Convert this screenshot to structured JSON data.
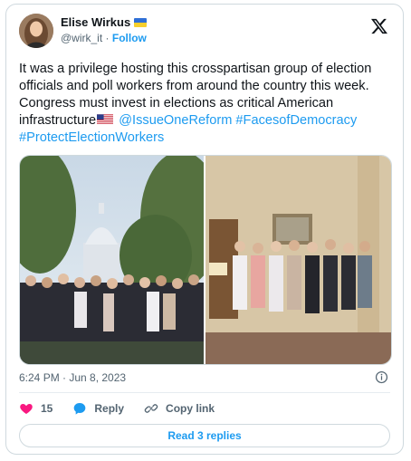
{
  "author": {
    "name": "Elise Wirkus",
    "handle": "@wirk_it",
    "separator": " · ",
    "follow_label": "Follow",
    "name_flag_icon": "ukraine-flag-icon"
  },
  "brand_icon": "x-logo-icon",
  "tweet": {
    "text_part1": "It was a privilege hosting this crosspartisan group of election officials and poll workers from around the country this week. Congress must invest in elections as critical American infrastructure",
    "inline_flag_icon": "us-flag-icon",
    "mention": "@IssueOneReform",
    "hashtag1": "#FacesofDemocracy",
    "hashtag2": "#ProtectElectionWorkers"
  },
  "media": {
    "photo1": "group-photo-capitol-outdoors",
    "photo2": "group-photo-office-indoors"
  },
  "meta": {
    "timestamp": "6:24 PM · Jun 8, 2023",
    "info_icon": "info-icon"
  },
  "actions": {
    "like_count": "15",
    "reply_label": "Reply",
    "copy_link_label": "Copy link"
  },
  "read_replies_label": "Read 3 replies",
  "colors": {
    "accent": "#1d9bf0",
    "like": "#f91880",
    "text": "#0f1419",
    "muted": "#536471",
    "border": "#cfd9de"
  }
}
